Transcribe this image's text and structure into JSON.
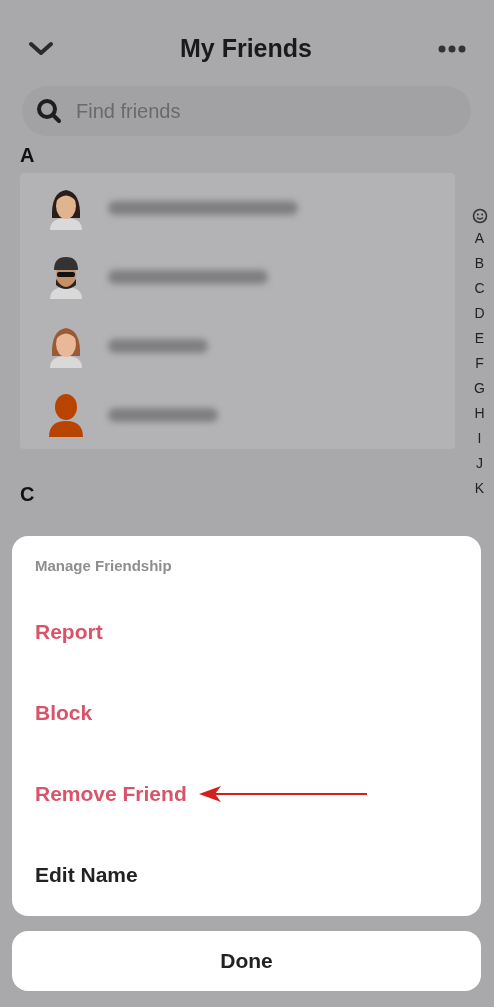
{
  "header": {
    "title": "My Friends"
  },
  "search": {
    "placeholder": "Find friends"
  },
  "sections": [
    {
      "letter": "A",
      "friends": [
        {
          "kind": "long-hair"
        },
        {
          "kind": "cap-beard"
        },
        {
          "kind": "wavy-hair"
        },
        {
          "kind": "silhouette"
        }
      ]
    },
    {
      "letter": "C"
    }
  ],
  "index": [
    "A",
    "B",
    "C",
    "D",
    "E",
    "F",
    "G",
    "H",
    "I",
    "J",
    "K"
  ],
  "sheet": {
    "title": "Manage Friendship",
    "actions": [
      {
        "label": "Report",
        "kind": "destructive",
        "highlighted": false
      },
      {
        "label": "Block",
        "kind": "destructive",
        "highlighted": false
      },
      {
        "label": "Remove Friend",
        "kind": "destructive",
        "highlighted": true
      },
      {
        "label": "Edit Name",
        "kind": "normal",
        "highlighted": false
      }
    ],
    "done": "Done"
  }
}
